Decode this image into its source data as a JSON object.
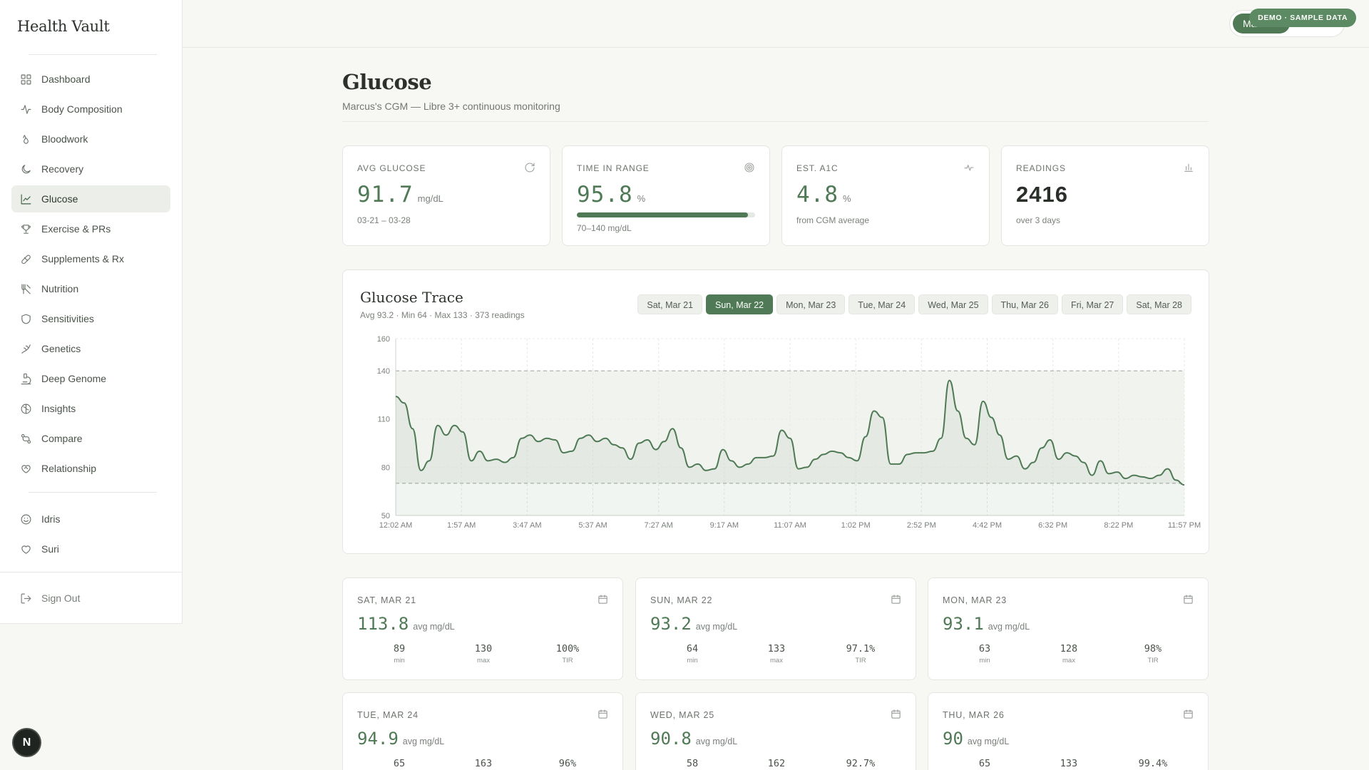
{
  "app": {
    "brand": "Health Vault"
  },
  "sidebar": {
    "items": [
      {
        "label": "Dashboard",
        "icon": "grid-icon",
        "name": "sidebar-item-dashboard"
      },
      {
        "label": "Body Composition",
        "icon": "activity-icon",
        "name": "sidebar-item-body-composition"
      },
      {
        "label": "Bloodwork",
        "icon": "droplets-icon",
        "name": "sidebar-item-bloodwork"
      },
      {
        "label": "Recovery",
        "icon": "moon-icon",
        "name": "sidebar-item-recovery"
      },
      {
        "label": "Glucose",
        "icon": "line-chart-icon",
        "name": "sidebar-item-glucose",
        "active": true
      },
      {
        "label": "Exercise & PRs",
        "icon": "trophy-icon",
        "name": "sidebar-item-exercise"
      },
      {
        "label": "Supplements & Rx",
        "icon": "pill-icon",
        "name": "sidebar-item-supplements"
      },
      {
        "label": "Nutrition",
        "icon": "utensils-icon",
        "name": "sidebar-item-nutrition"
      },
      {
        "label": "Sensitivities",
        "icon": "shield-icon",
        "name": "sidebar-item-sensitivities"
      },
      {
        "label": "Genetics",
        "icon": "dna-icon",
        "name": "sidebar-item-genetics"
      },
      {
        "label": "Deep Genome",
        "icon": "microscope-icon",
        "name": "sidebar-item-deep-genome"
      },
      {
        "label": "Insights",
        "icon": "brain-icon",
        "name": "sidebar-item-insights"
      },
      {
        "label": "Compare",
        "icon": "compare-icon",
        "name": "sidebar-item-compare"
      },
      {
        "label": "Relationship",
        "icon": "heart-handshake-icon",
        "name": "sidebar-item-relationship"
      }
    ],
    "people": [
      {
        "label": "Idris",
        "icon": "smile-icon",
        "name": "sidebar-item-idris"
      },
      {
        "label": "Suri",
        "icon": "heart-icon",
        "name": "sidebar-item-suri"
      }
    ],
    "sign_out": "Sign Out"
  },
  "topbar": {
    "user": "Marcus",
    "badge": "DEMO · SAMPLE DATA"
  },
  "page": {
    "title": "Glucose",
    "subtitle": "Marcus's CGM — Libre 3+ continuous monitoring"
  },
  "stats": [
    {
      "label": "AVG GLUCOSE",
      "value": "91.7",
      "unit": "mg/dL",
      "note": "03-21 – 03-28",
      "icon": "refresh-icon"
    },
    {
      "label": "TIME IN RANGE",
      "value": "95.8",
      "unit": "%",
      "note": "70–140 mg/dL",
      "progress": 0.958,
      "icon": "target-icon"
    },
    {
      "label": "EST. A1C",
      "value": "4.8",
      "unit": "%",
      "note": "from CGM average",
      "icon": "pulse-icon"
    },
    {
      "label": "READINGS",
      "value": "2416",
      "unit": "",
      "note": "over 3 days",
      "icon": "bar-chart-icon"
    }
  ],
  "trace": {
    "title": "Glucose Trace",
    "subtitle": "Avg 93.2 · Min 64 · Max 133 · 373 readings",
    "tabs": [
      "Sat, Mar 21",
      "Sun, Mar 22",
      "Mon, Mar 23",
      "Tue, Mar 24",
      "Wed, Mar 25",
      "Thu, Mar 26",
      "Fri, Mar 27",
      "Sat, Mar 28"
    ],
    "active_tab": 1
  },
  "chart_data": {
    "type": "line",
    "title": "Glucose Trace",
    "xlabel": "",
    "ylabel": "",
    "ylim": [
      50,
      160
    ],
    "yticks": [
      50,
      80,
      110,
      140,
      160
    ],
    "xticks": [
      "12:02 AM",
      "1:57 AM",
      "3:47 AM",
      "5:37 AM",
      "7:27 AM",
      "9:17 AM",
      "11:07 AM",
      "1:02 PM",
      "2:52 PM",
      "4:42 PM",
      "6:32 PM",
      "8:22 PM",
      "11:57 PM"
    ],
    "target_range": [
      70,
      140
    ],
    "grid": true,
    "series": [
      {
        "color": "#4f7a55",
        "values": [
          124,
          120,
          104,
          78,
          84,
          106,
          100,
          106,
          102,
          84,
          90,
          84,
          85,
          83,
          86,
          98,
          100,
          96,
          98,
          97,
          89,
          90,
          98,
          100,
          96,
          98,
          94,
          92,
          85,
          95,
          97,
          91,
          96,
          104,
          92,
          80,
          82,
          78,
          79,
          91,
          84,
          80,
          82,
          86,
          86,
          87,
          103,
          98,
          79,
          80,
          85,
          88,
          90,
          89,
          86,
          84,
          99,
          115,
          111,
          82,
          82,
          88,
          89,
          89,
          90,
          98,
          134,
          115,
          98,
          94,
          121,
          111,
          100,
          85,
          87,
          79,
          83,
          92,
          97,
          85,
          89,
          87,
          83,
          75,
          84,
          76,
          77,
          73,
          75,
          74,
          73,
          75,
          79,
          72,
          69
        ]
      }
    ]
  },
  "days": [
    {
      "label": "SAT, MAR 21",
      "avg": "113.8",
      "unit": "avg mg/dL",
      "min": "89",
      "max": "130",
      "tir": "100%"
    },
    {
      "label": "SUN, MAR 22",
      "avg": "93.2",
      "unit": "avg mg/dL",
      "min": "64",
      "max": "133",
      "tir": "97.1%"
    },
    {
      "label": "MON, MAR 23",
      "avg": "93.1",
      "unit": "avg mg/dL",
      "min": "63",
      "max": "128",
      "tir": "98%"
    },
    {
      "label": "TUE, MAR 24",
      "avg": "94.9",
      "unit": "avg mg/dL",
      "min": "65",
      "max": "163",
      "tir": "96%"
    },
    {
      "label": "WED, MAR 25",
      "avg": "90.8",
      "unit": "avg mg/dL",
      "min": "58",
      "max": "162",
      "tir": "92.7%"
    },
    {
      "label": "THU, MAR 26",
      "avg": "90",
      "unit": "avg mg/dL",
      "min": "65",
      "max": "133",
      "tir": "99.4%"
    }
  ],
  "day_stat_labels": {
    "min": "min",
    "max": "max",
    "tir": "TIR"
  },
  "dev_badge": "N"
}
